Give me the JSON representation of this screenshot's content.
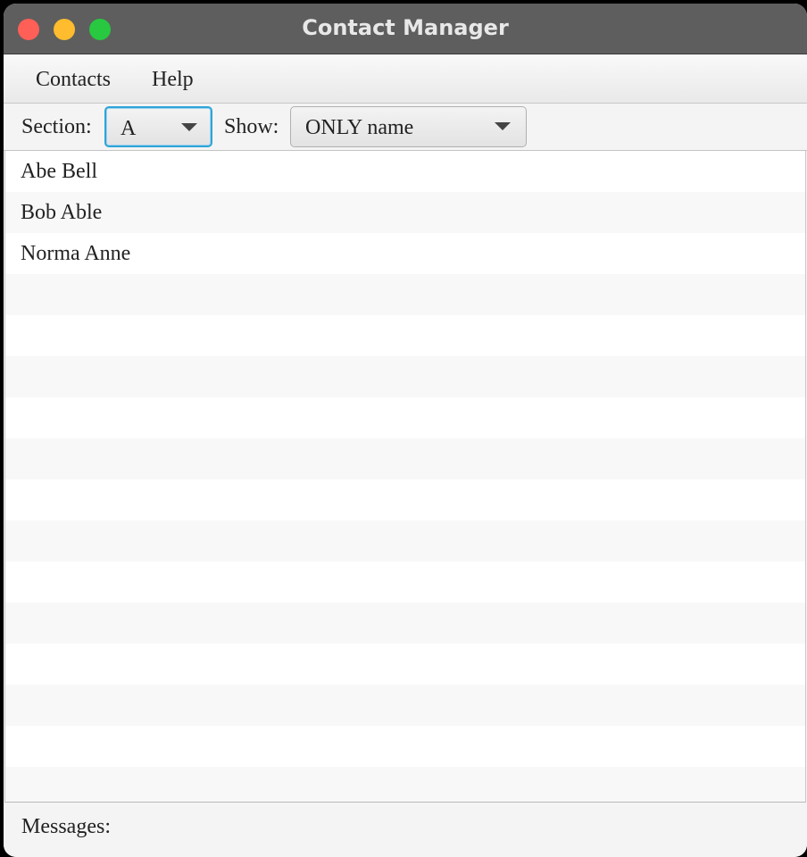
{
  "window": {
    "title": "Contact Manager"
  },
  "menu": {
    "items": [
      "Contacts",
      "Help"
    ]
  },
  "toolbar": {
    "section_label": "Section:",
    "section_value": "A",
    "show_label": "Show:",
    "show_value": "ONLY name"
  },
  "list": {
    "items": [
      "Abe Bell",
      "Bob Able",
      "Norma Anne"
    ],
    "empty_rows": 13
  },
  "status": {
    "messages_label": "Messages:"
  },
  "colors": {
    "titlebar": "#5e5e5e",
    "close": "#fe5f57",
    "minimize": "#febc2e",
    "maximize": "#28c840",
    "focus_accent": "#2ea4d8",
    "stripe": "#f8f8f8"
  }
}
